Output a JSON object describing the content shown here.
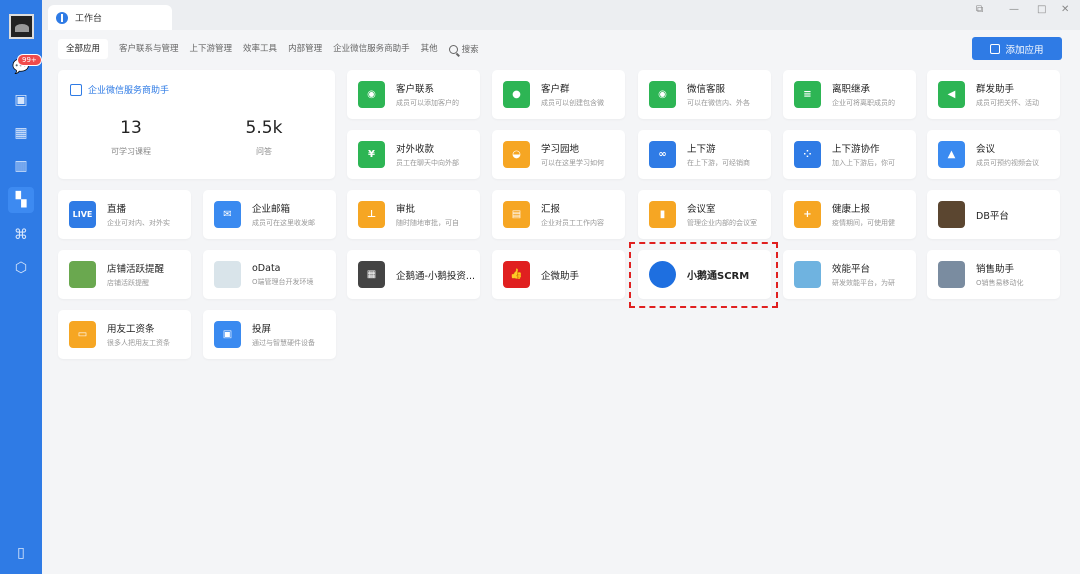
{
  "rail": {
    "badge": "99+"
  },
  "window": {
    "tab_title": "工作台"
  },
  "nav": {
    "items": [
      "全部应用",
      "客户联系与管理",
      "上下游管理",
      "效率工具",
      "内部管理",
      "企业微信服务商助手",
      "其他"
    ],
    "search_label": "搜索"
  },
  "add_app_label": "添加应用",
  "info_card": {
    "title": "企业微信服务商助手",
    "stats": [
      {
        "value": "13",
        "label": "可学习课程"
      },
      {
        "value": "5.5k",
        "label": "问答"
      }
    ]
  },
  "apps": [
    {
      "name": "客户联系",
      "desc": "成员可以添加客户的",
      "color": "#2db554",
      "glyph": "◉"
    },
    {
      "name": "客户群",
      "desc": "成员可以创建包含微",
      "color": "#2db554",
      "glyph": "●"
    },
    {
      "name": "微信客服",
      "desc": "可以在微信内、外各",
      "color": "#2db554",
      "glyph": "◉"
    },
    {
      "name": "离职继承",
      "desc": "企业可将离职成员的",
      "color": "#2db554",
      "glyph": "≡"
    },
    {
      "name": "群发助手",
      "desc": "成员可把关怀、活动",
      "color": "#2db554",
      "glyph": "◀"
    },
    {
      "name": "对外收款",
      "desc": "员工在聊天中向外部",
      "color": "#2db554",
      "glyph": "¥"
    },
    {
      "name": "学习园地",
      "desc": "可以在这里学习如何",
      "color": "#f6a623",
      "glyph": "◒"
    },
    {
      "name": "上下游",
      "desc": "在上下游，可经销商",
      "color": "#2f7be5",
      "glyph": "∞"
    },
    {
      "name": "上下游协作",
      "desc": "加入上下游后，你可",
      "color": "#2f7be5",
      "glyph": "⁘"
    },
    {
      "name": "会议",
      "desc": "成员可预约视频会议",
      "color": "#3a8af0",
      "glyph": "▲"
    },
    {
      "name": "直播",
      "desc": "企业可对内、对外实",
      "color": "#2f7be5",
      "glyph": "LIVE"
    },
    {
      "name": "企业邮箱",
      "desc": "成员可在这里收发邮",
      "color": "#3a8af0",
      "glyph": "✉"
    },
    {
      "name": "审批",
      "desc": "随时随地审批，可自",
      "color": "#f6a623",
      "glyph": "⊥"
    },
    {
      "name": "汇报",
      "desc": "企业对员工工作内容",
      "color": "#f6a623",
      "glyph": "▤"
    },
    {
      "name": "会议室",
      "desc": "管理企业内部的会议室",
      "color": "#f6a623",
      "glyph": "▮"
    },
    {
      "name": "健康上报",
      "desc": "疫情期间，可使用健",
      "color": "#f6a623",
      "glyph": "+"
    },
    {
      "name": "DB平台",
      "desc": "",
      "color": "#5b4630",
      "glyph": ""
    },
    {
      "name": "店铺活跃提醒",
      "desc": "店铺活跃提醒",
      "color": "#6aa84f",
      "glyph": ""
    },
    {
      "name": "oData",
      "desc": "O端管理台开发环境",
      "color": "#d9e4ea",
      "glyph": ""
    },
    {
      "name": "企鹅通-小鹅投资...",
      "desc": "",
      "color": "#444444",
      "glyph": "▦"
    },
    {
      "name": "企微助手",
      "desc": "",
      "color": "#e02020",
      "glyph": "👍"
    },
    {
      "name": "小鹅通SCRM",
      "desc": "",
      "color": "#1e6fe0",
      "glyph": ""
    },
    {
      "name": "效能平台",
      "desc": "研发效能平台，为研",
      "color": "#6fb3e0",
      "glyph": ""
    },
    {
      "name": "销售助手",
      "desc": "O销售易移动化",
      "color": "#7a8ca0",
      "glyph": ""
    },
    {
      "name": "用友工资条",
      "desc": "很多人把用友工资条",
      "color": "#f6a623",
      "glyph": "▭"
    },
    {
      "name": "投屏",
      "desc": "通过与智慧硬件设备",
      "color": "#3a8af0",
      "glyph": "▣"
    }
  ]
}
